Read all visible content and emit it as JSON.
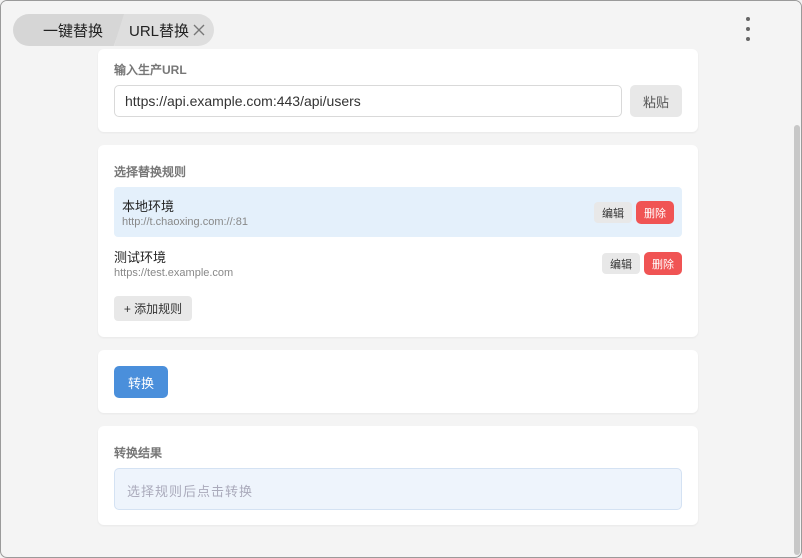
{
  "tabs": [
    {
      "label": "一键替换"
    },
    {
      "label": "URL替换"
    }
  ],
  "input_section": {
    "title": "输入生产URL",
    "url_value": "https://api.example.com:443/api/users",
    "paste_label": "粘贴"
  },
  "rules_section": {
    "title": "选择替换规则",
    "rules": [
      {
        "name": "本地环境",
        "url": "http://t.chaoxing.com://:81",
        "edit_label": "编辑",
        "delete_label": "删除",
        "selected": true
      },
      {
        "name": "测试环境",
        "url": "https://test.example.com",
        "edit_label": "编辑",
        "delete_label": "删除",
        "selected": false
      }
    ],
    "add_label": "+ 添加规则"
  },
  "convert": {
    "label": "转换"
  },
  "result_section": {
    "title": "转换结果",
    "placeholder": "选择规则后点击转换"
  },
  "colors": {
    "accent": "#4a8fdb",
    "danger": "#f05454",
    "selected_row": "#e4f0fb"
  }
}
